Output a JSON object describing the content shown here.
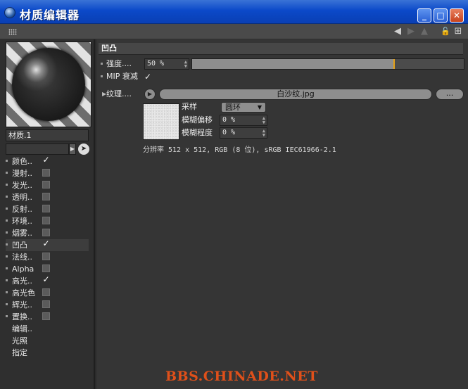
{
  "window": {
    "title": "材质编辑器",
    "minimize_glyph": "_",
    "maximize_glyph": "□",
    "close_glyph": "✕"
  },
  "toolbar": {
    "icons": [
      "grip-icon",
      "arrow-left-icon",
      "arrow-right-icon",
      "arrow-up-icon",
      "lock-icon",
      "new-window-icon"
    ],
    "back_glyph": "◀",
    "forward_glyph": "▶",
    "up_glyph": "▲",
    "lock_glyph": "🔓",
    "newwin_glyph": "⊞"
  },
  "material": {
    "name": "材质.1",
    "path_value": ""
  },
  "channels": [
    {
      "label": "颜色..",
      "checked": true,
      "active": false
    },
    {
      "label": "漫射..",
      "checked": false,
      "active": false
    },
    {
      "label": "发光..",
      "checked": false,
      "active": false
    },
    {
      "label": "透明..",
      "checked": false,
      "active": false
    },
    {
      "label": "反射..",
      "checked": false,
      "active": false
    },
    {
      "label": "环境..",
      "checked": false,
      "active": false
    },
    {
      "label": "烟雾..",
      "checked": false,
      "active": false
    },
    {
      "label": "凹凸",
      "checked": true,
      "active": true
    },
    {
      "label": "法线..",
      "checked": false,
      "active": false
    },
    {
      "label": "Alpha",
      "checked": false,
      "active": false
    },
    {
      "label": "高光..",
      "checked": true,
      "active": false
    },
    {
      "label": "高光色",
      "checked": false,
      "active": false
    },
    {
      "label": "辉光..",
      "checked": false,
      "active": false
    },
    {
      "label": "置换..",
      "checked": false,
      "active": false
    },
    {
      "label": "编辑..",
      "checked": null,
      "active": false
    },
    {
      "label": "光照",
      "checked": null,
      "active": false
    },
    {
      "label": "指定",
      "checked": null,
      "active": false
    }
  ],
  "bump": {
    "section_title": "凹凸",
    "strength_label": "强度....",
    "strength_value": "50 %",
    "strength_fraction": 0.74,
    "mip_label": "MIP 衰减",
    "mip_checked": true,
    "texture_label": "纹理....",
    "texture_file": "白沙纹.jpg",
    "texture_more": "...",
    "sampling_label": "采样",
    "sampling_value": "圆环",
    "blur_offset_label": "模糊偏移",
    "blur_offset_value": "0 %",
    "blur_scale_label": "模糊程度",
    "blur_scale_value": "0 %",
    "resolution_info": "分辨率 512 x 512, RGB (8 位), sRGB IEC61966-2.1"
  },
  "watermark": "BBS.CHINADE.NET",
  "colors": {
    "titlebar": "#0b49c9",
    "slider_marker": "#e3a016",
    "watermark": "#e0501a"
  }
}
